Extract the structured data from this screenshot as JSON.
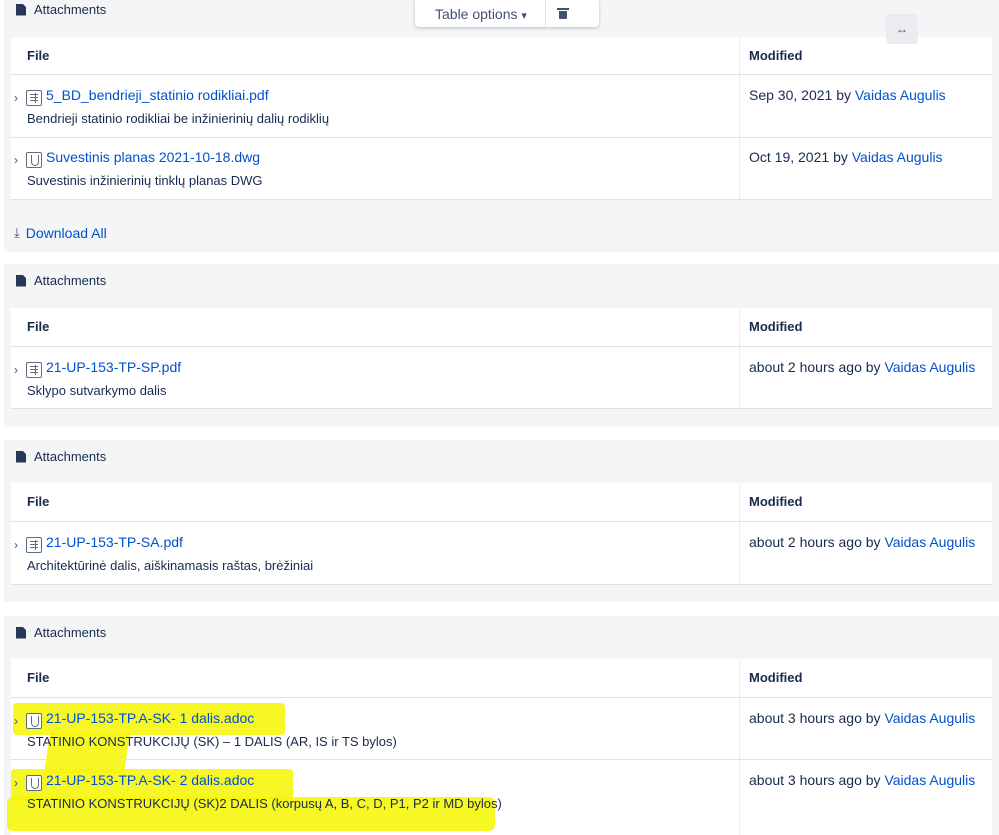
{
  "toolbar": {
    "table_options": "Table options",
    "chevron": "⌄"
  },
  "download_all": "Download All",
  "panels": [
    {
      "heading": "Attachments",
      "col_file": "File",
      "col_modified": "Modified",
      "rows": [
        {
          "icon": "pdf-file-icon",
          "name": "5_BD_bendrieji_statinio rodikliai.pdf",
          "desc": "Bendrieji statinio rodikliai be inžinierinių dalių rodiklių",
          "date": "Sep 30, 2021",
          "by": "by",
          "user": "Vaidas Augulis"
        },
        {
          "icon": "dwg-file-icon",
          "name": "Suvestinis planas 2021-10-18.dwg",
          "desc": "Suvestinis inžinierinių tinklų planas DWG",
          "date": "Oct 19, 2021",
          "by": "by",
          "user": "Vaidas Augulis"
        }
      ]
    },
    {
      "heading": "Attachments",
      "col_file": "File",
      "col_modified": "Modified",
      "rows": [
        {
          "icon": "pdf-file-icon",
          "name": "21-UP-153-TP-SP.pdf",
          "desc": "Sklypo sutvarkymo dalis",
          "date": "about 2 hours ago",
          "by": "by",
          "user": "Vaidas Augulis"
        }
      ]
    },
    {
      "heading": "Attachments",
      "col_file": "File",
      "col_modified": "Modified",
      "rows": [
        {
          "icon": "pdf-file-icon",
          "name": "21-UP-153-TP-SA.pdf",
          "desc": "Architektūrinė dalis, aiškinamasis raštas, brėžiniai",
          "date": "about 2 hours ago",
          "by": "by",
          "user": "Vaidas Augulis"
        }
      ]
    },
    {
      "heading": "Attachments",
      "col_file": "File",
      "col_modified": "Modified",
      "rows": [
        {
          "icon": "dwg-file-icon",
          "name": "21-UP-153-TP.A-SK- 1 dalis.adoc",
          "desc": "STATINIO KONSTRUKCIJŲ (SK) – 1 DALIS (AR, IS ir TS bylos)",
          "date": "about 3 hours ago",
          "by": "by",
          "user": "Vaidas Augulis"
        },
        {
          "icon": "dwg-file-icon",
          "name": "21-UP-153-TP.A-SK- 2 dalis.adoc",
          "desc": "STATINIO KONSTRUKCIJŲ (SK)2 DALIS (korpusų A, B, C, D, P1, P2 ir MD bylos)",
          "date": "about 3 hours ago",
          "by": "by",
          "user": "Vaidas Augulis"
        }
      ]
    }
  ],
  "colors": {
    "highlight": "#f6f600",
    "link": "#0052cc",
    "panel_bg": "#f4f5f7"
  }
}
